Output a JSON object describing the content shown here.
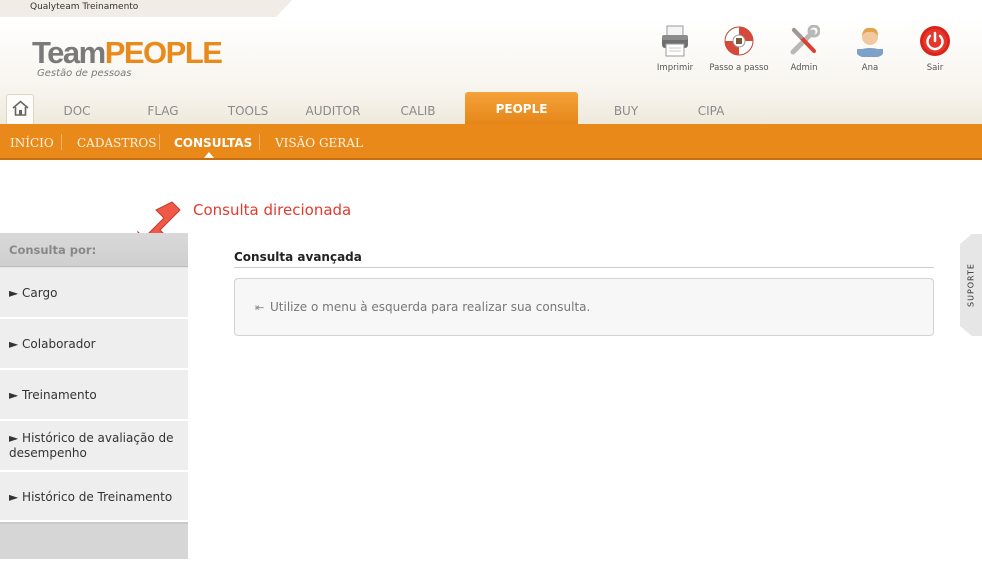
{
  "company": {
    "name": "Qualyteam Treinamento"
  },
  "brand": {
    "logo_team": "Team",
    "logo_people": "PEOPLE",
    "tagline": "Gestão de pessoas",
    "accent_color": "#e8891a",
    "annotation_color": "#e23b2e"
  },
  "toolbar": [
    {
      "icon": "printer-icon",
      "label": "Imprimir"
    },
    {
      "icon": "lifebuoy-icon",
      "label": "Passo a passo"
    },
    {
      "icon": "tools-icon",
      "label": "Admin"
    },
    {
      "icon": "user-icon",
      "label": "Ana"
    },
    {
      "icon": "power-icon",
      "label": "Sair"
    }
  ],
  "main_tabs": {
    "home_icon": "home-icon",
    "items": [
      "DOC",
      "FLAG",
      "TOOLS",
      "AUDITOR",
      "CALIB",
      "PEOPLE",
      "BUY",
      "CIPA"
    ],
    "active": "PEOPLE"
  },
  "sub_nav": {
    "items": [
      "INÍCIO",
      "CADASTROS",
      "CONSULTAS",
      "VISÃO GERAL"
    ],
    "active": "CONSULTAS"
  },
  "annotation": {
    "text": "Consulta direcionada"
  },
  "sidebar": {
    "header": "Consulta por:",
    "items": [
      {
        "label": "► Cargo"
      },
      {
        "label": "► Colaborador"
      },
      {
        "label": "► Treinamento"
      },
      {
        "label": "► Histórico de avaliação de desempenho"
      },
      {
        "label": "► Histórico de Treinamento"
      }
    ]
  },
  "content": {
    "title": "Consulta avançada",
    "info_icon": "◄◄",
    "info_text": "Utilize o menu à esquerda para realizar sua consulta."
  },
  "support": {
    "label": "SUPORTE"
  }
}
